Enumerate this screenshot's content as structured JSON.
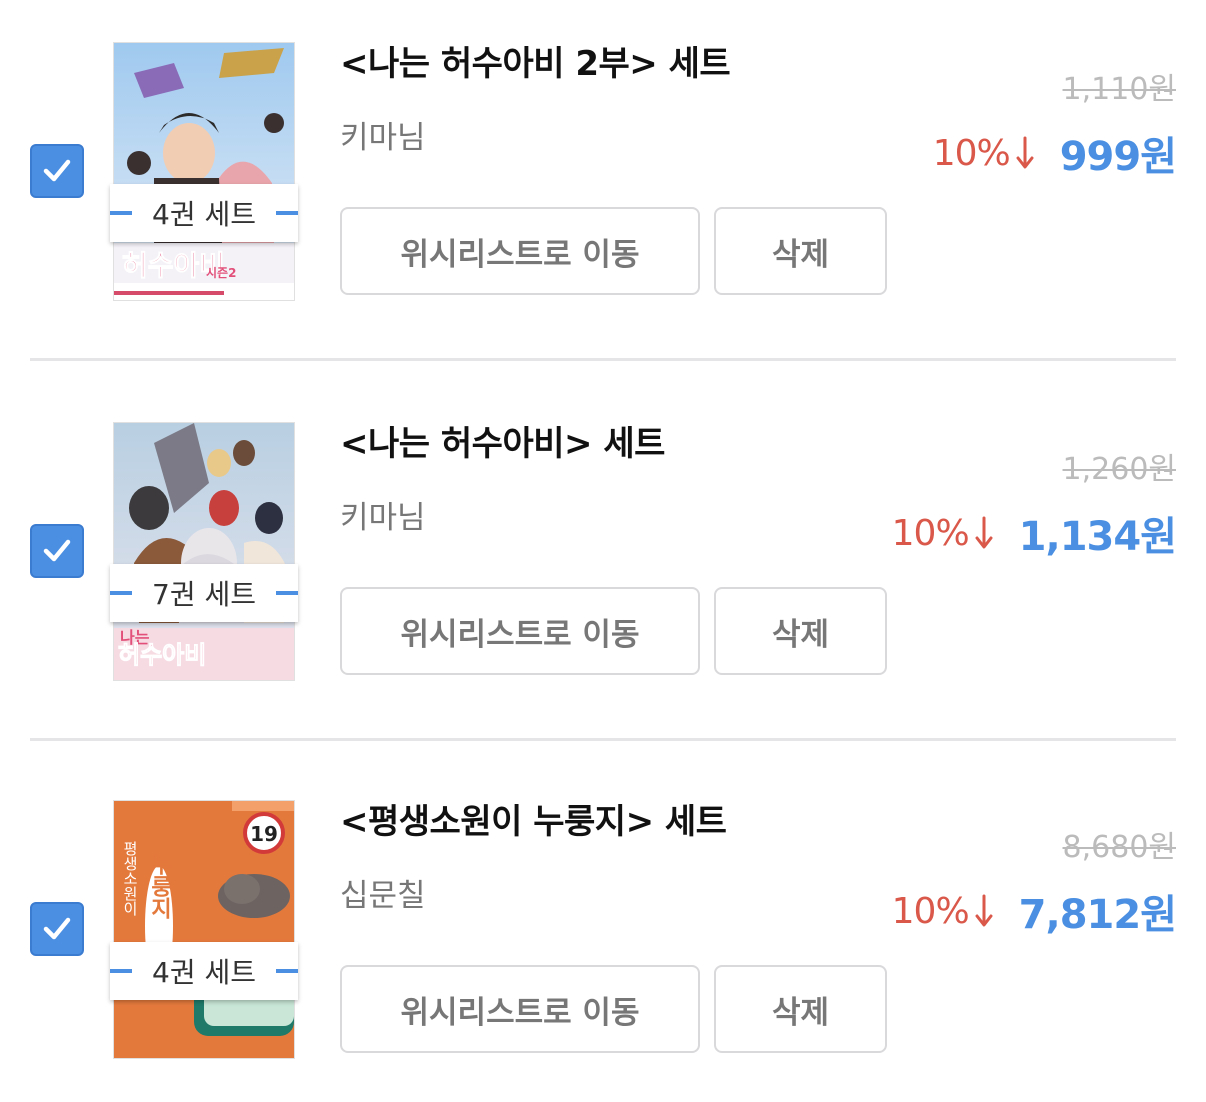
{
  "items": [
    {
      "title": "<나는 허수아비 2부> 세트",
      "author": "키마님",
      "set_label": "4권 세트",
      "wishlist_label": "위시리스트로 이동",
      "delete_label": "삭제",
      "original_price": "1,110원",
      "discount": "10%",
      "final_price": "999원",
      "checked": true,
      "cover_text": "허수아비",
      "cover_sub": "시즌2"
    },
    {
      "title": "<나는 허수아비> 세트",
      "author": "키마님",
      "set_label": "7권 세트",
      "wishlist_label": "위시리스트로 이동",
      "delete_label": "삭제",
      "original_price": "1,260원",
      "discount": "10%",
      "final_price": "1,134원",
      "checked": true,
      "cover_text": "허수아비",
      "cover_sub": "나는"
    },
    {
      "title": "<평생소원이 누룽지> 세트",
      "author": "십문칠",
      "set_label": "4권 세트",
      "wishlist_label": "위시리스트로 이동",
      "delete_label": "삭제",
      "original_price": "8,680원",
      "discount": "10%",
      "final_price": "7,812원",
      "checked": true,
      "cover_text": "누룽지",
      "cover_sub": "평생소원이",
      "cover_badge": "19"
    }
  ],
  "colors": {
    "accent": "#4a8fe2",
    "discount": "#d9584a",
    "strike": "#bbbbbb",
    "divider": "#e5e5e8"
  }
}
